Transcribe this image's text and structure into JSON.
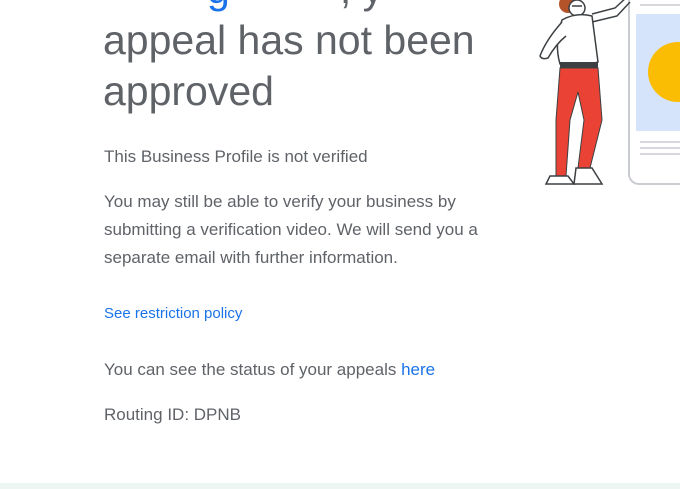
{
  "heading": {
    "line1_partial_blue": "g",
    "line1_partial_rest": ", y",
    "line2": "appeal has not been",
    "line3": "approved"
  },
  "status_line": "This Business Profile is not verified",
  "body_text": "You may still be able to verify your business by submitting a verification video. We will send you a separate email with further information.",
  "policy_link": "See restriction policy",
  "appeals": {
    "prefix": "You can see the status of your appeals ",
    "link": "here"
  },
  "routing": "Routing ID: DPNB",
  "colors": {
    "text": "#5f6368",
    "link": "#1a73e8",
    "accent_yellow": "#fbbc04",
    "accent_red": "#ea4335"
  }
}
